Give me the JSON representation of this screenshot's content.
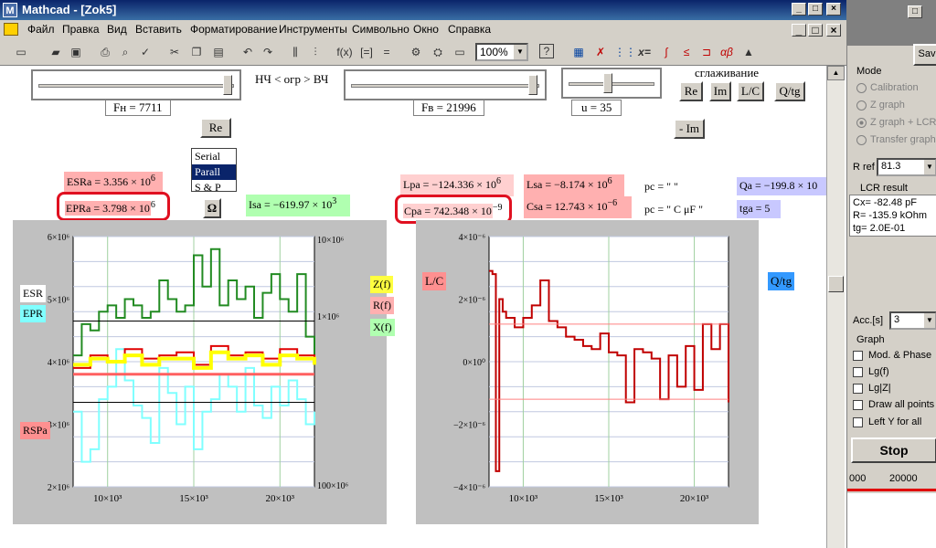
{
  "window": {
    "title": "Mathcad - [Zok5]"
  },
  "menu": [
    "Файл",
    "Правка",
    "Вид",
    "Вставить",
    "Форматирование",
    "Инструменты",
    "Символьно",
    "Окно",
    "Справка"
  ],
  "toolbar": {
    "zoom": "100%"
  },
  "sliders": {
    "fn_label": "Fн = 7711",
    "fv_label": "Fв = 21996",
    "u_label": "u = 35",
    "range_text": "НЧ < огр > ВЧ",
    "smoothing": "сглаживание"
  },
  "buttons": {
    "re": "Re",
    "im": "Im",
    "lc": "L/C",
    "qtg": "Q/tg",
    "re2": "Re",
    "minus_im": "- Im",
    "omega": "Ω"
  },
  "listbox": {
    "items": [
      "Serial",
      "Parall",
      "S & P"
    ],
    "selected": "Parall"
  },
  "equations": {
    "esra": "ESRa = 3.356 × 10",
    "esra_exp": "6",
    "epra": "EPRa = 3.798 × 10",
    "epra_exp": "6",
    "isa": "Isa = −619.97 × 10",
    "isa_exp": "3",
    "lpa": "Lpa = −124.336 × 10",
    "lpa_exp": "6",
    "cpa": "Cpa = 742.348 × 10",
    "cpa_exp": "−9",
    "lsa": "Lsa = −8.174 × 10",
    "lsa_exp": "6",
    "csa": "Csa = 12.743 × 10",
    "csa_exp": "−6",
    "pc1": "pc = \"         \"",
    "pc2": "pc = \"  C  μF  \"",
    "qa": "Qa = −199.8 × 10",
    "tga": "tga = 5"
  },
  "plot_left": {
    "legend": [
      "ESR",
      "EPR",
      "RSPa"
    ],
    "legend_right": [
      "Z(f)",
      "R(f)",
      "X(f)"
    ],
    "y_ticks": [
      "6×10⁶",
      "5×10⁶",
      "4×10⁶",
      "3×10⁶",
      "2×10⁶"
    ],
    "y2_ticks": [
      "10×10⁶",
      "1×10⁶",
      "100×10⁶"
    ],
    "x_ticks": [
      "10×10³",
      "15×10³",
      "20×10³"
    ]
  },
  "plot_right": {
    "legend": "L/C",
    "y_ticks": [
      "4×10⁻⁶",
      "2×10⁻⁶",
      "0×10⁰",
      "−2×10⁻⁶",
      "−4×10⁻⁶"
    ],
    "x_ticks": [
      "10×10³",
      "15×10³",
      "20×10³"
    ],
    "qtg_btn": "Q/tg"
  },
  "chart_data": [
    {
      "type": "line",
      "x_range": [
        8000,
        22000
      ],
      "ylim": [
        2000000,
        6000000
      ],
      "series": [
        {
          "name": "ESR",
          "color": "#228b22",
          "x": [
            8000,
            8500,
            9000,
            9500,
            10000,
            10500,
            11000,
            11500,
            12000,
            12500,
            13000,
            13500,
            14000,
            14500,
            15000,
            15500,
            16000,
            16500,
            17000,
            17500,
            18000,
            18500,
            19000,
            19500,
            20000,
            20500,
            21000,
            21500,
            22000
          ],
          "y": [
            4100000,
            4600000,
            4500000,
            4800000,
            4900000,
            4700000,
            5000000,
            4900000,
            4700000,
            4800000,
            5300000,
            5000000,
            4800000,
            4900000,
            5700000,
            5200000,
            5800000,
            4900000,
            5300000,
            5000000,
            5200000,
            4700000,
            5100000,
            5400000,
            5000000,
            4800000,
            5400000,
            4400000,
            4100000
          ]
        },
        {
          "name": "EPR",
          "color": "#80ffff",
          "x": [
            8000,
            8500,
            9000,
            9500,
            10000,
            10500,
            11000,
            11500,
            12000,
            12500,
            13000,
            13500,
            14000,
            14500,
            15000,
            15500,
            16000,
            16500,
            17000,
            17500,
            18000,
            18500,
            19000,
            19500,
            20000,
            20500,
            21000,
            21500,
            22000
          ],
          "y": [
            3200000,
            2400000,
            2600000,
            3400000,
            3600000,
            4200000,
            3700000,
            3300000,
            3100000,
            2700000,
            3900000,
            3500000,
            3000000,
            3600000,
            2600000,
            3200000,
            3400000,
            3800000,
            3600000,
            3200000,
            3900000,
            3300000,
            3100000,
            3600000,
            3300000,
            3700000,
            3400000,
            3000000,
            3200000
          ]
        },
        {
          "name": "RSPa",
          "color": "#e00000",
          "x": [
            8000,
            9000,
            10000,
            11000,
            12000,
            13000,
            14000,
            15000,
            16000,
            17000,
            18000,
            19000,
            20000,
            21000,
            22000
          ],
          "y": [
            3900000,
            4100000,
            4000000,
            4200000,
            4050000,
            4100000,
            4150000,
            3950000,
            4250000,
            4100000,
            4150000,
            4050000,
            4200000,
            4100000,
            4000000
          ]
        },
        {
          "name": "Z(f)",
          "color": "#ffff00",
          "x": [
            8000,
            9000,
            10000,
            11000,
            12000,
            13000,
            14000,
            15000,
            16000,
            17000,
            18000,
            19000,
            20000,
            21000,
            22000
          ],
          "y": [
            3950000,
            4050000,
            4000000,
            4100000,
            3950000,
            4050000,
            4050000,
            3900000,
            4150000,
            4050000,
            4100000,
            3950000,
            4100000,
            4050000,
            3950000
          ]
        }
      ]
    },
    {
      "type": "line",
      "x_range": [
        8000,
        22000
      ],
      "ylim": [
        -4e-06,
        4e-06
      ],
      "series": [
        {
          "name": "L/C",
          "color": "#c00000",
          "x": [
            8000,
            8200,
            8400,
            8600,
            8800,
            9000,
            9500,
            10000,
            10500,
            11000,
            11500,
            12000,
            12500,
            13000,
            13500,
            14000,
            14500,
            15000,
            15500,
            16000,
            16500,
            17000,
            17500,
            18000,
            18500,
            19000,
            19500,
            20000,
            20500,
            21000,
            21500,
            22000
          ],
          "y": [
            2.9e-06,
            2.8e-06,
            -3.5e-06,
            2e-06,
            1.6e-06,
            1.4e-06,
            1.1e-06,
            1.4e-06,
            1.8e-06,
            2.6e-06,
            1.3e-06,
            1.1e-06,
            8e-07,
            7e-07,
            5e-07,
            4e-07,
            9e-07,
            3e-07,
            2e-07,
            -1.3e-06,
            4e-07,
            3e-07,
            1e-07,
            -1.2e-06,
            2e-07,
            -8e-07,
            5e-07,
            -9e-07,
            1.2e-06,
            4e-07,
            1.2e-06,
            -1.3e-06
          ]
        }
      ]
    }
  ],
  "right_panel": {
    "save": "Sav",
    "mode_title": "Mode",
    "modes": [
      "Calibration",
      "Z graph",
      "Z graph + LCR",
      "Transfer graph"
    ],
    "mode_selected": "Z graph + LCR",
    "rref_label": "R ref",
    "rref_value": "81.3",
    "result_title": "LCR result",
    "results": [
      "Cx= -82.48 pF",
      "R= -135.9 kOhm",
      "tg= 2.0E-01"
    ],
    "acc_label": "Acc.[s]",
    "acc_value": "3",
    "graph_title": "Graph",
    "checks": [
      "Mod. & Phase",
      "Lg(f)",
      "Lg|Z|",
      "Draw all points",
      "Left Y for all"
    ],
    "stop": "Stop",
    "axis": [
      "000",
      "20000"
    ]
  }
}
